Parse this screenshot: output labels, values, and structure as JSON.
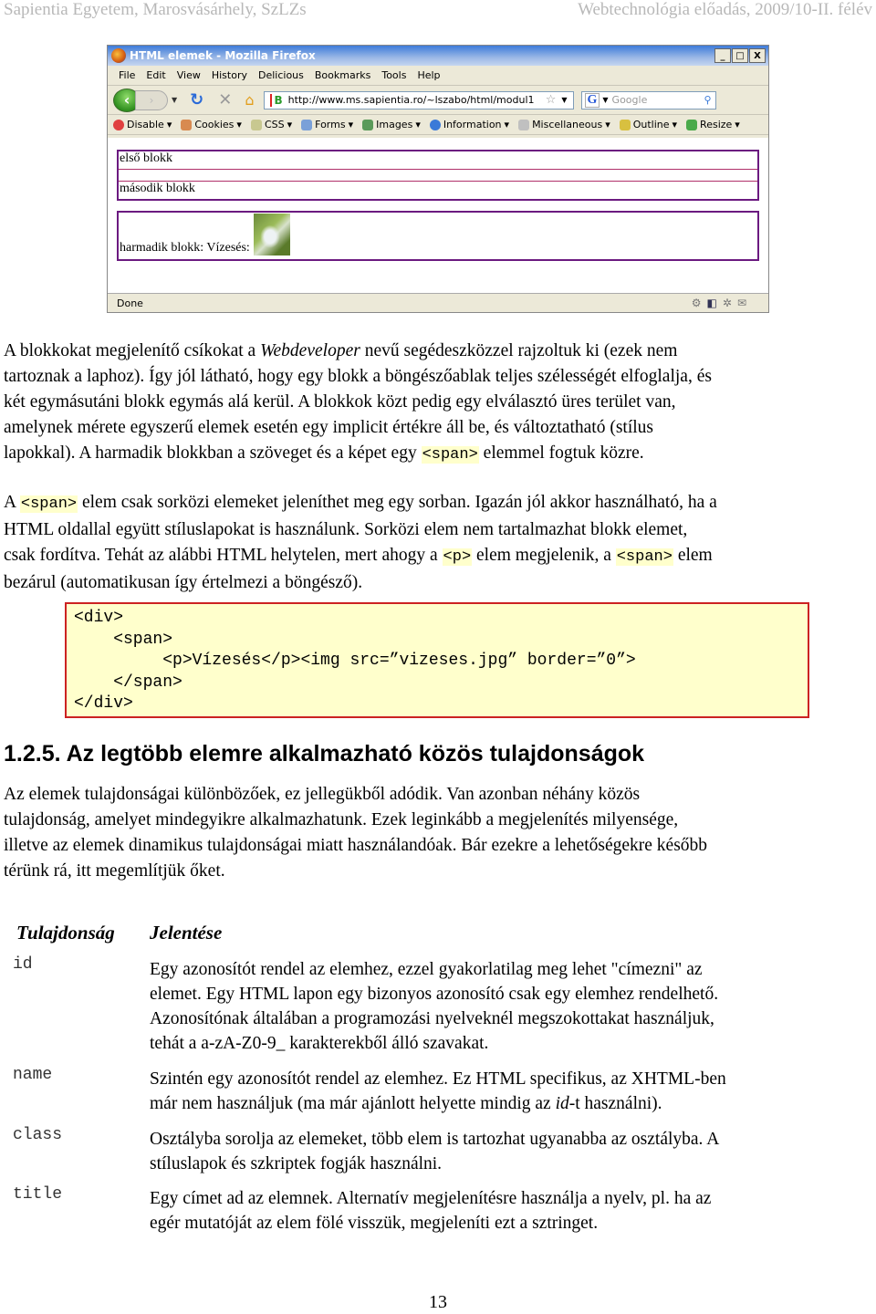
{
  "header": {
    "left": "Sapientia Egyetem, Marosvásárhely, SzLZs",
    "right": "Webtechnológia előadás, 2009/10-II. félév"
  },
  "browser": {
    "title": "HTML elemek - Mozilla Firefox",
    "window_buttons": [
      "_",
      "□",
      "X"
    ],
    "menu": [
      "File",
      "Edit",
      "View",
      "History",
      "Delicious",
      "Bookmarks",
      "Tools",
      "Help"
    ],
    "url": "http://www.ms.sapientia.ro/~lszabo/html/modul1",
    "search_placeholder": "Google",
    "webdev_toolbar": [
      {
        "label": "Disable",
        "icon": "disable-icon",
        "color": "#e04040"
      },
      {
        "label": "Cookies",
        "icon": "cookies-icon",
        "color": "#d88a50"
      },
      {
        "label": "CSS",
        "icon": "css-icon",
        "color": "#c8c890"
      },
      {
        "label": "Forms",
        "icon": "forms-icon",
        "color": "#7aa0d8"
      },
      {
        "label": "Images",
        "icon": "images-icon",
        "color": "#5a9a5a"
      },
      {
        "label": "Information",
        "icon": "information-icon",
        "color": "#3a7ad8"
      },
      {
        "label": "Miscellaneous",
        "icon": "miscellaneous-icon",
        "color": "#c0c0c0"
      },
      {
        "label": "Outline",
        "icon": "outline-icon",
        "color": "#d8c040"
      },
      {
        "label": "Resize",
        "icon": "resize-icon",
        "color": "#4aaa4a"
      }
    ],
    "content": {
      "block1": "első blokk",
      "block2": "második blokk",
      "block3": "harmadik blokk: Vízesés:"
    },
    "status": "Done"
  },
  "paragraphs": {
    "p1": {
      "l1a": "A blokkokat megjelenítő csíkokat a ",
      "l1em": "Webdeveloper",
      "l1b": " nevű segédeszközzel rajzoltuk ki (ezek nem",
      "l2": "tartoznak a laphoz). Így jól látható, hogy egy blokk a böngészőablak teljes szélességét elfoglalja, és",
      "l3": "két egymásutáni blokk egymás alá kerül. A blokkok közt pedig egy elválasztó üres terület van,",
      "l4": "amelynek mérete egyszerű elemek esetén egy implicit értékre áll be, és változtatható (stílus",
      "l5a": "lapokkal). A harmadik blokkban a szöveget és a képet egy ",
      "l5code": "<span>",
      "l5b": " elemmel fogtuk közre."
    },
    "p2": {
      "l1a": "A ",
      "l1code": "<span>",
      "l1b": " elem csak sorközi elemeket jeleníthet meg egy sorban. Igazán jól akkor használható, ha a",
      "l2": "HTML oldallal együtt stíluslapokat is használunk. Sorközi  elem nem tartalmazhat blokk elemet,",
      "l3a": "csak fordítva. Tehát az alábbi HTML helytelen, mert ahogy a ",
      "l3code1": "<p>",
      "l3b": " elem megjelenik, a ",
      "l3code2": "<span>",
      "l3c": " elem",
      "l4": "bezárul (automatikusan  így értelmezi a böngésző)."
    }
  },
  "code_example": "<div>\n    <span>\n         <p>Vízesés</p><img src=”vizeses.jpg” border=”0”>\n    </span>\n</div>",
  "section": {
    "title": "1.2.5.  Az legtöbb elemre alkalmazható közös tulajdonságok",
    "intro": [
      "Az elemek tulajdonságai különbözőek, ez jellegükből adódik. Van azonban néhány közös",
      "tulajdonság, amelyet mindegyikre alkalmazhatunk. Ezek  leginkább a megjelenítés milyensége,",
      "illetve az elemek dinamikus tulajdonságai miatt használandóak. Bár ezekre  a lehetőségekre később",
      "térünk rá, itt megemlítjük őket."
    ]
  },
  "table": {
    "headers": [
      "Tulajdonság",
      "Jelentése"
    ],
    "rows": [
      {
        "prop": "id",
        "lines": [
          "Egy azonosítót rendel az elemhez, ezzel gyakorlatilag meg lehet \"címezni\" az",
          "elemet. Egy HTML lapon egy bizonyos azonosító csak egy elemhez rendelhető.",
          "Azonosítónak általában a programozási nyelveknél megszokottakat használjuk,",
          "tehát a a-zA-Z0-9_ karakterekből álló szavakat."
        ]
      },
      {
        "prop": "name",
        "lines": [
          "Szintén egy azonosítót rendel az elemhez. Ez HTML specifikus, az XHTML-ben"
        ],
        "l2a": "már nem használjuk (ma már ajánlott helyette mindig az ",
        "l2em": "id",
        "l2b": "-t használni)."
      },
      {
        "prop": "class",
        "lines": [
          "Osztályba sorolja az elemeket, több elem is tartozhat ugyanabba az osztályba. A",
          "stíluslapok és szkriptek fogják használni."
        ]
      },
      {
        "prop": "title",
        "lines": [
          "Egy címet ad az elemnek. Alternatív megjelenítésre használja a nyelv, pl. ha az",
          "egér mutatóját az elem fölé visszük, megjeleníti ezt a sztringet."
        ]
      }
    ]
  },
  "page_number": "13"
}
